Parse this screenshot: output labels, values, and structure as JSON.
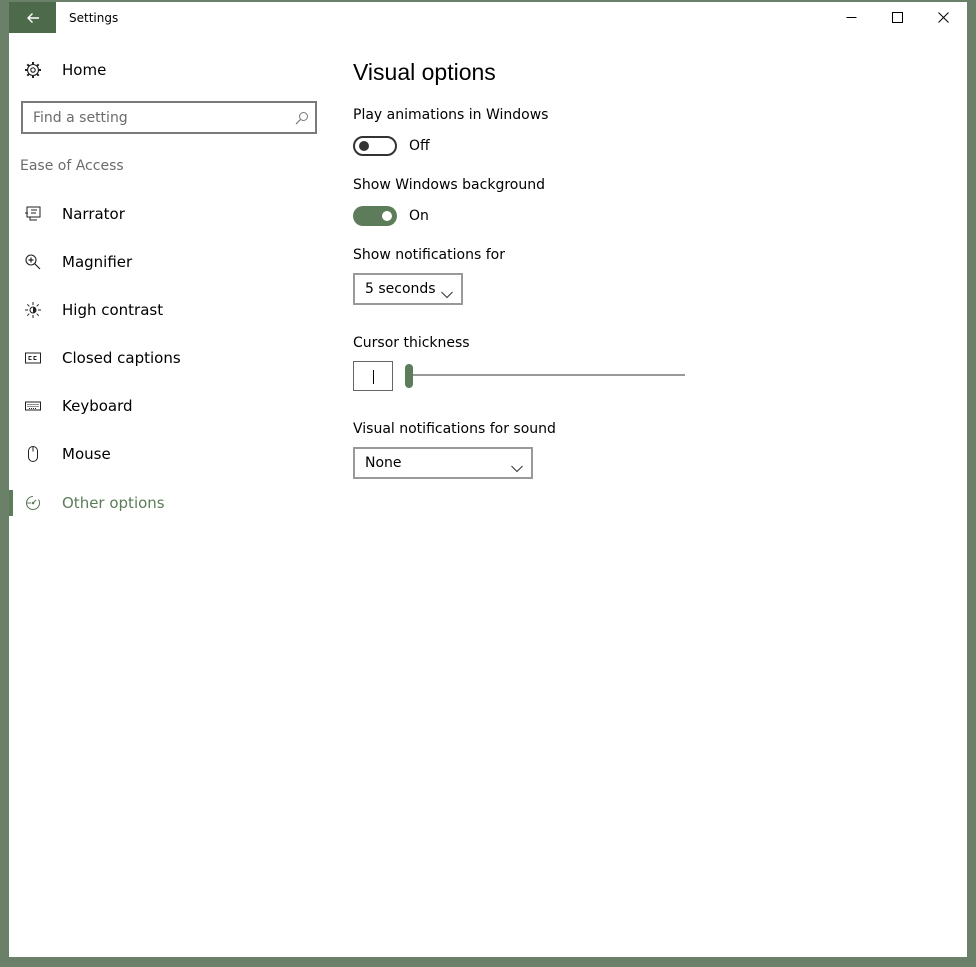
{
  "window": {
    "title": "Settings"
  },
  "icons": {
    "back": "back-arrow-icon",
    "minimize": "minimize-icon",
    "maximize": "maximize-icon",
    "close": "close-icon"
  },
  "sidebar": {
    "home_label": "Home",
    "search_placeholder": "Find a setting",
    "section_title": "Ease of Access",
    "items": [
      {
        "label": "Narrator",
        "icon": "narrator-icon"
      },
      {
        "label": "Magnifier",
        "icon": "magnifier-icon"
      },
      {
        "label": "High contrast",
        "icon": "high-contrast-icon"
      },
      {
        "label": "Closed captions",
        "icon": "closed-captions-icon"
      },
      {
        "label": "Keyboard",
        "icon": "keyboard-icon"
      },
      {
        "label": "Mouse",
        "icon": "mouse-icon"
      },
      {
        "label": "Other options",
        "icon": "other-options-icon",
        "active": true
      }
    ]
  },
  "main": {
    "title": "Visual options",
    "play_animations": {
      "label": "Play animations in Windows",
      "state": "Off"
    },
    "show_background": {
      "label": "Show Windows background",
      "state": "On"
    },
    "notifications": {
      "label": "Show notifications for",
      "value": "5 seconds"
    },
    "cursor": {
      "label": "Cursor thickness",
      "value_fraction": 0.0
    },
    "visual_sound": {
      "label": "Visual notifications for sound",
      "value": "None"
    }
  },
  "colors": {
    "accent": "#5d7d5a",
    "frame": "#6b8068"
  }
}
